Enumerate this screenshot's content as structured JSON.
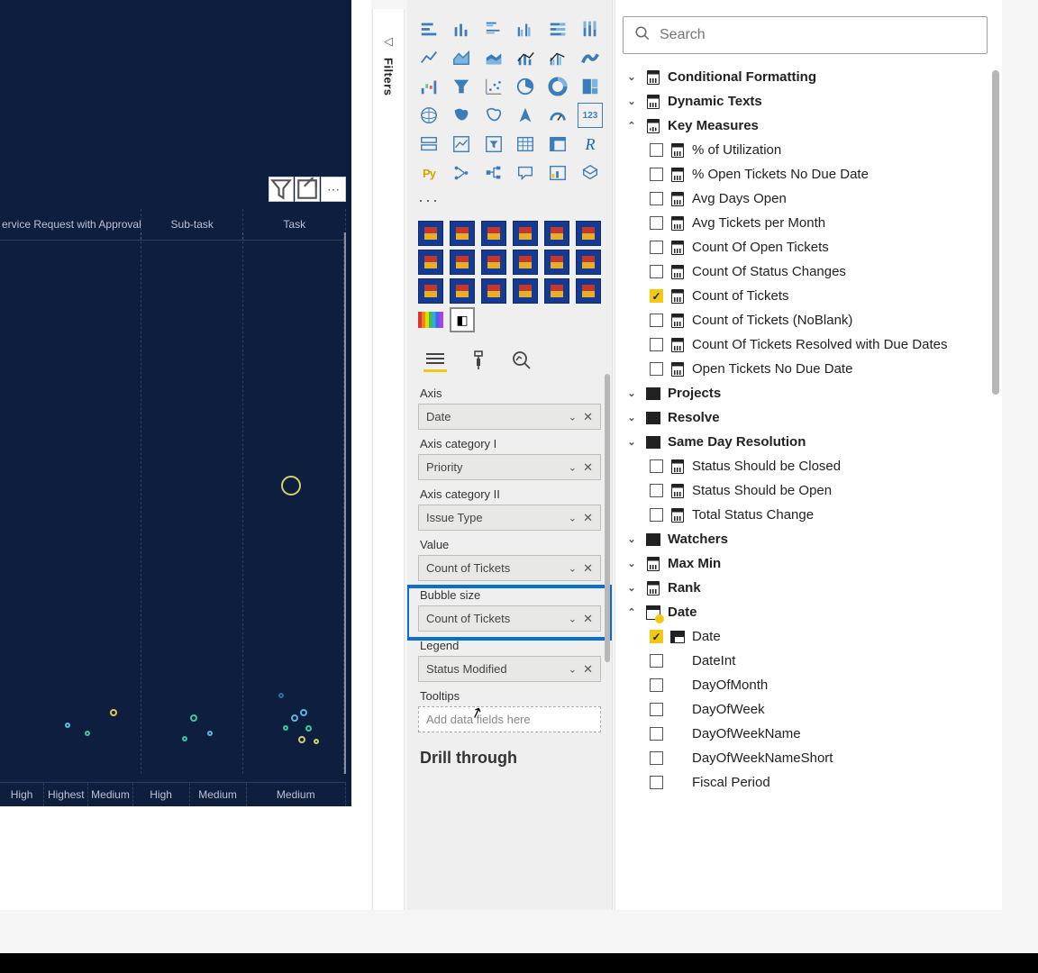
{
  "filters": {
    "label": "Filters"
  },
  "chart": {
    "columns": [
      "ervice Request with Approvals",
      "Sub-task",
      "Task"
    ],
    "footer": [
      "High",
      "Highest",
      "Medium",
      "High",
      "Medium",
      "Medium"
    ]
  },
  "search": {
    "placeholder": "Search"
  },
  "wells": {
    "axis": {
      "label": "Axis",
      "value": "Date"
    },
    "cat1": {
      "label": "Axis category I",
      "value": "Priority"
    },
    "cat2": {
      "label": "Axis category II",
      "value": "Issue Type"
    },
    "value": {
      "label": "Value",
      "value": "Count of Tickets"
    },
    "bubble": {
      "label": "Bubble size",
      "value": "Count of Tickets"
    },
    "legend": {
      "label": "Legend",
      "value": "Status Modified"
    },
    "tooltips": {
      "label": "Tooltips",
      "placeholder": "Add data fields here"
    }
  },
  "drill": {
    "label": "Drill through"
  },
  "tables": {
    "cond": {
      "name": "Conditional Formatting"
    },
    "dyn": {
      "name": "Dynamic Texts"
    },
    "key": {
      "name": "Key Measures",
      "cols": [
        {
          "name": "% of Utilization",
          "checked": false
        },
        {
          "name": "% Open Tickets No Due Date",
          "checked": false
        },
        {
          "name": "Avg Days Open",
          "checked": false
        },
        {
          "name": "Avg Tickets per Month",
          "checked": false
        },
        {
          "name": "Count Of Open Tickets",
          "checked": false
        },
        {
          "name": "Count Of Status Changes",
          "checked": false
        },
        {
          "name": "Count of Tickets",
          "checked": true
        },
        {
          "name": "Count of Tickets (NoBlank)",
          "checked": false
        },
        {
          "name": "Count Of Tickets Resolved with Due Dates",
          "checked": false
        },
        {
          "name": "Open Tickets No Due Date",
          "checked": false
        }
      ]
    },
    "projects": {
      "name": "Projects"
    },
    "resolve": {
      "name": "Resolve"
    },
    "sdr": {
      "name": "Same Day Resolution",
      "cols": [
        {
          "name": "Status Should be Closed",
          "checked": false
        },
        {
          "name": "Status Should be Open",
          "checked": false
        },
        {
          "name": "Total Status Change",
          "checked": false
        }
      ]
    },
    "watchers": {
      "name": "Watchers"
    },
    "maxmin": {
      "name": "Max Min"
    },
    "rank": {
      "name": "Rank"
    },
    "date": {
      "name": "Date",
      "cols": [
        {
          "name": "Date",
          "checked": true,
          "hier": true
        },
        {
          "name": "DateInt",
          "checked": false
        },
        {
          "name": "DayOfMonth",
          "checked": false
        },
        {
          "name": "DayOfWeek",
          "checked": false
        },
        {
          "name": "DayOfWeekName",
          "checked": false
        },
        {
          "name": "DayOfWeekNameShort",
          "checked": false
        },
        {
          "name": "Fiscal Period",
          "checked": false
        }
      ]
    }
  }
}
